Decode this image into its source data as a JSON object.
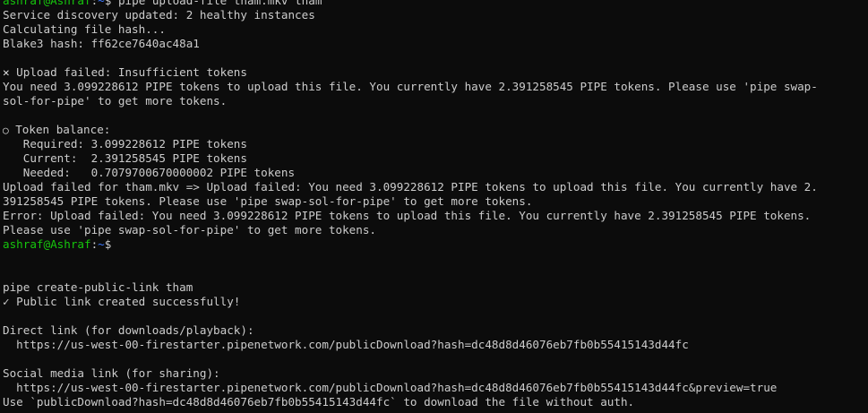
{
  "prompt": {
    "user_host": "ashraf@Ashraf",
    "separator": ":",
    "path": "~",
    "symbol": "$"
  },
  "first_command": " pipe upload-file tham.mkv tham",
  "lines": {
    "l1": "Service discovery updated: 2 healthy instances",
    "l2": "Calculating file hash...",
    "l3": "Blake3 hash: ff62ce7640ac48a1",
    "l4_text": " Upload failed: Insufficient tokens",
    "l5": "You need 3.099228612 PIPE tokens to upload this file. You currently have 2.391258545 PIPE tokens. Please use 'pipe swap-",
    "l6": "sol-for-pipe' to get more tokens.",
    "l7_text": " Token balance:",
    "l8": "   Required: 3.099228612 PIPE tokens",
    "l9": "   Current:  2.391258545 PIPE tokens",
    "l10": "   Needed:   0.7079700670000002 PIPE tokens",
    "l11": "Upload failed for tham.mkv => Upload failed: You need 3.099228612 PIPE tokens to upload this file. You currently have 2.",
    "l12": "391258545 PIPE tokens. Please use 'pipe swap-sol-for-pipe' to get more tokens.",
    "l13": "Error: Upload failed: You need 3.099228612 PIPE tokens to upload this file. You currently have 2.391258545 PIPE tokens.",
    "l14": "Please use 'pipe swap-sol-for-pipe' to get more tokens.",
    "l15": "pipe create-public-link tham",
    "l16_text": " Public link created successfully!",
    "l17": "Direct link (for downloads/playback):",
    "l18": "  https://us-west-00-firestarter.pipenetwork.com/publicDownload?hash=dc48d8d46076eb7fb0b55415143d44fc",
    "l19": "Social media link (for sharing):",
    "l20": "  https://us-west-00-firestarter.pipenetwork.com/publicDownload?hash=dc48d8d46076eb7fb0b55415143d44fc&preview=true",
    "l21": "Use `publicDownload?hash=dc48d8d46076eb7fb0b55415143d44fc` to download the file without auth."
  },
  "icons": {
    "error": "✕",
    "money_bag": "💰",
    "check": "✓"
  },
  "colors": {
    "background": "#0c0c0c",
    "text": "#cccccc",
    "prompt_user": "#16c60c",
    "prompt_path": "#3b78ff"
  }
}
